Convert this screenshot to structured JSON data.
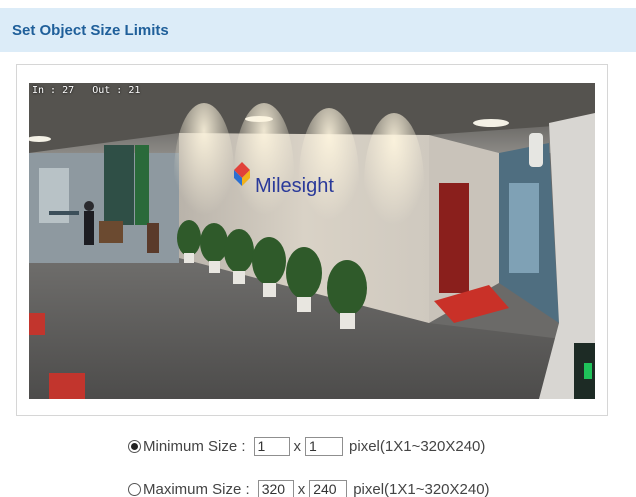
{
  "header": {
    "title": "Set Object Size Limits"
  },
  "video": {
    "overlay_text": "In : 27   Out : 21",
    "brand_sign": "Milesight"
  },
  "min_size": {
    "label": "Minimum Size :",
    "width": "1",
    "separator": "x",
    "height": "1",
    "range": "pixel(1X1~320X240)",
    "selected": true
  },
  "max_size": {
    "label": "Maximum Size :",
    "width": "320",
    "separator": "x",
    "height": "240",
    "range": "pixel(1X1~320X240)",
    "selected": false
  },
  "colors": {
    "header_bg": "#dcecf8",
    "header_text": "#1f5f9a"
  }
}
